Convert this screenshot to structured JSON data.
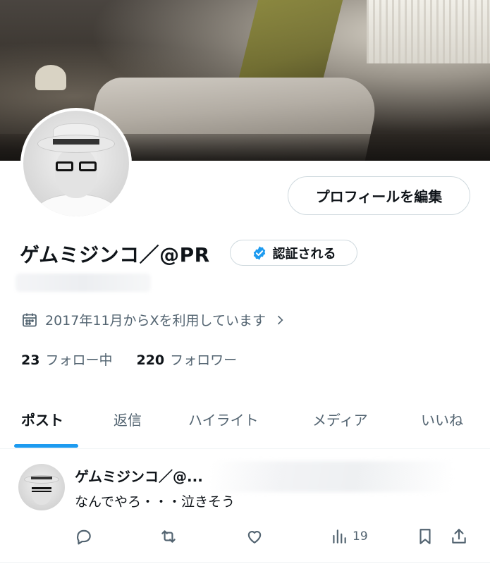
{
  "profile": {
    "display_name": "ゲムミジンコ／@PR",
    "verify_label": "認証される",
    "edit_profile_label": "プロフィールを編集",
    "joined_text": "2017年11月からXを利用しています",
    "following_count": "23",
    "following_label": "フォロー中",
    "followers_count": "220",
    "followers_label": "フォロワー"
  },
  "tabs": [
    {
      "label": "ポスト",
      "active": true
    },
    {
      "label": "返信",
      "active": false
    },
    {
      "label": "ハイライト",
      "active": false
    },
    {
      "label": "メディア",
      "active": false
    },
    {
      "label": "いいね",
      "active": false
    }
  ],
  "post": {
    "author_name": "ゲムミジンコ／@...",
    "text": "なんでやろ・・・泣きそう",
    "views_count": "19"
  },
  "colors": {
    "accent": "#1d9bf0",
    "text_primary": "#0f1419",
    "text_secondary": "#536471",
    "border": "#cfd9de"
  }
}
